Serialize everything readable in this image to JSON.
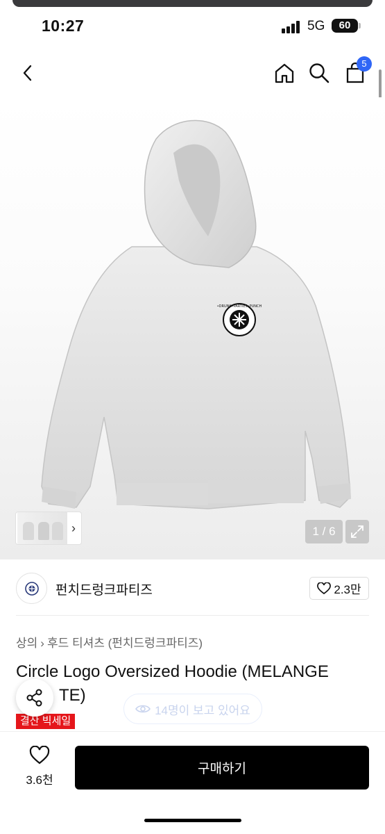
{
  "status_bar": {
    "time": "10:27",
    "network": "5G",
    "battery": "60"
  },
  "nav": {
    "back_icon": "chevron-left-icon",
    "home_icon": "home-icon",
    "search_icon": "search-icon",
    "cart_icon": "shopping-bag-icon",
    "cart_count": "5"
  },
  "gallery": {
    "counter": "1 / 6",
    "logo_text": "•DRUNK•PARTIES•PUNCH"
  },
  "brand": {
    "name": "펀치드렁크파티즈",
    "likes": "2.3만"
  },
  "breadcrumb": {
    "category": "상의",
    "subcategory": "후드 티셔츠 (펀치드렁크파티즈)"
  },
  "product": {
    "title_line1": "Circle Logo Oversized Hoodie (MELANGE",
    "title_line2": "TE)",
    "sale_badge": "결산 빅세일",
    "viewers": "14명이 보고 있어요"
  },
  "bottom_bar": {
    "like_count": "3.6천",
    "buy_label": "구매하기"
  },
  "colors": {
    "accent": "#2f66f6",
    "sale": "#e5161b",
    "buy_button": "#000000"
  }
}
